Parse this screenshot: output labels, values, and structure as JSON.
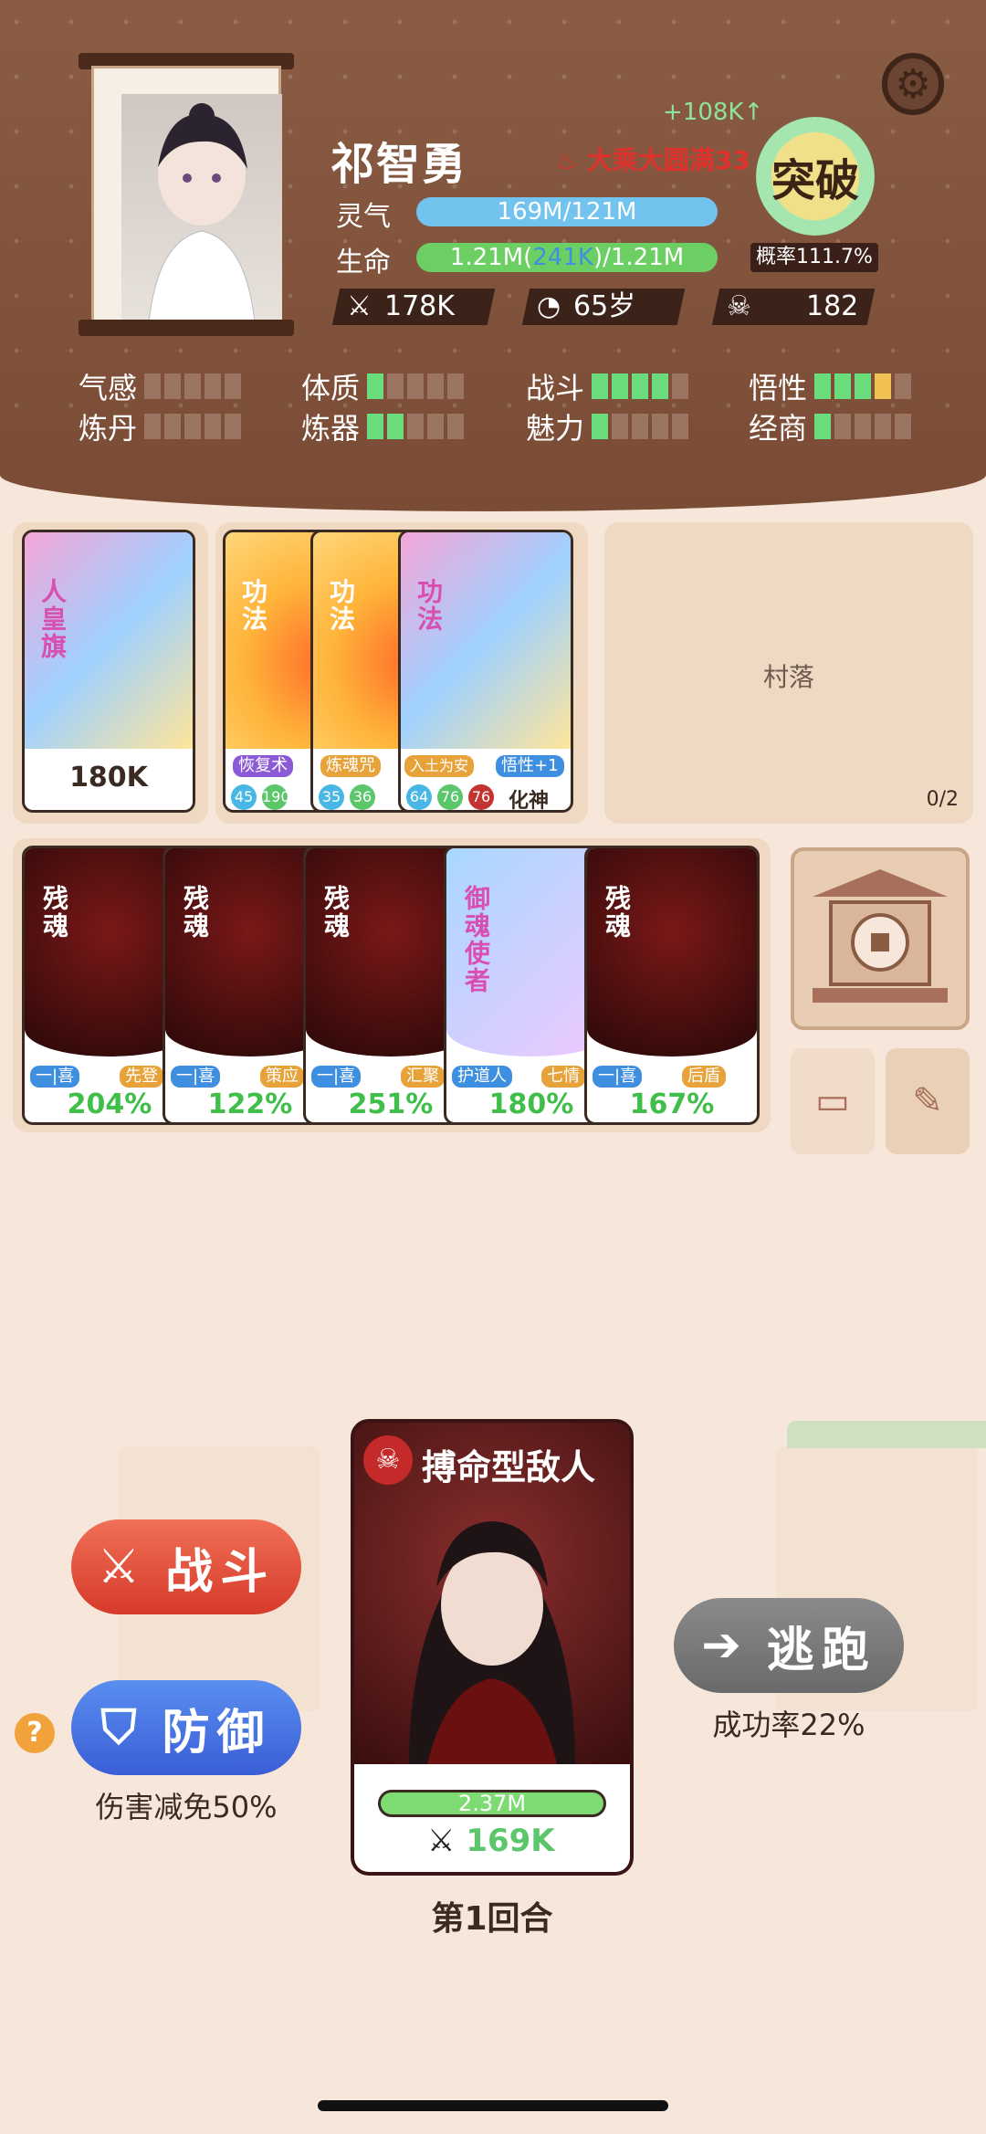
{
  "header": {
    "name": "祁智勇",
    "gain": "+108K↑",
    "realm": "大乘大圆满33",
    "break_label": "突破",
    "break_prob": "概率111.7%",
    "lingqi_label": "灵气",
    "lingqi_value": "169M/121M",
    "life_label": "生命",
    "life_value_a": "1.21M(",
    "life_value_b": "241K",
    "life_value_c": ")/1.21M",
    "attack": "178K",
    "age": "65岁",
    "kills": "182",
    "colors": {
      "lingqi": "#72c3ee",
      "life": "#6ccf63",
      "realm": "#e0322c"
    }
  },
  "attributes": [
    {
      "label": "气感",
      "level": 0
    },
    {
      "label": "体质",
      "level": 1
    },
    {
      "label": "战斗",
      "level": 4
    },
    {
      "label": "悟性",
      "level": 4,
      "extra": "y"
    },
    {
      "label": "炼丹",
      "level": 0
    },
    {
      "label": "炼器",
      "level": 2
    },
    {
      "label": "魅力",
      "level": 1
    },
    {
      "label": "经商",
      "level": 1
    }
  ],
  "treasure": {
    "title": "人皇旗",
    "power": "180K"
  },
  "skills": [
    {
      "title": "功法",
      "tag": "恢复术",
      "n1": "45",
      "n2": "190"
    },
    {
      "title": "功法",
      "tag": "炼魂咒",
      "n1": "35",
      "n2": "36"
    },
    {
      "title": "功法",
      "tag": "入土为安",
      "tag2": "悟性+1",
      "n1": "64",
      "n2": "76",
      "n3": "76",
      "stage": "化神"
    }
  ],
  "village": {
    "label": "村落",
    "count": "0/2"
  },
  "souls": [
    {
      "title": "残魂",
      "tag1": "一|喜",
      "tag2": "先登",
      "pct": "204%"
    },
    {
      "title": "残魂",
      "tag1": "一|喜",
      "tag2": "策应",
      "pct": "122%"
    },
    {
      "title": "残魂",
      "tag1": "一|喜",
      "tag2": "汇聚",
      "pct": "251%"
    },
    {
      "title": "御魂使者",
      "tag1": "护道人",
      "tag2": "七情",
      "pct": "180%"
    },
    {
      "title": "残魂",
      "tag1": "一|喜",
      "tag2": "后盾",
      "pct": "167%"
    }
  ],
  "battle": {
    "fight_label": "战斗",
    "defend_label": "防御",
    "defend_note": "伤害减免50%",
    "flee_label": "逃跑",
    "flee_note": "成功率22%",
    "enemy_title": "搏命型敌人",
    "enemy_hp": "2.37M",
    "enemy_attack": "169K",
    "round": "第1回合",
    "help": "?"
  }
}
